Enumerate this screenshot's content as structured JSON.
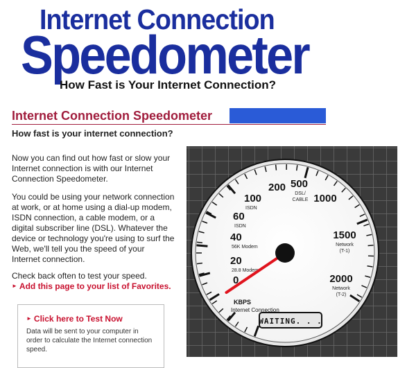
{
  "logo": {
    "line1": "Internet Connection",
    "line2": "Speedometer",
    "tagline": "How Fast is Your Internet Connection?"
  },
  "header": {
    "title": "Internet Connection Speedometer",
    "subtitle": "How fast is your internet connection?"
  },
  "content": {
    "para1": "Now you can find out how fast or slow your Internet connection is with our Internet Connection Speedometer.",
    "para2": "You could be using your network connection at work, or at home using a dial-up modem, ISDN connection, a cable modem, or a digital subscriber line (DSL). Whatever the device or technology you're using to surf the Web, we'll tell you the speed of your Internet connection.",
    "para3": "Check back often to test your speed.",
    "favorites_link": "Add this page to your list of Favorites."
  },
  "test_box": {
    "link": "Click here to Test Now",
    "note": "Data will be sent to your computer in order to calculate the Internet connection speed."
  },
  "gauge": {
    "ticks": [
      {
        "value": "0"
      },
      {
        "value": "20",
        "sub": "28.8 Modem"
      },
      {
        "value": "40",
        "sub": "56K Modem"
      },
      {
        "value": "60",
        "sub": "ISDN"
      },
      {
        "value": "100",
        "sub": "ISDN"
      },
      {
        "value": "200"
      },
      {
        "value": "500",
        "sub": "DSL/ CABLE"
      },
      {
        "value": "1000"
      },
      {
        "value": "1500",
        "sub": "Network (T-1)"
      },
      {
        "value": "2000",
        "sub": "Network (T-2)"
      }
    ],
    "units": "KBPS",
    "units_sub": "Internet Connection",
    "status": "WAITING. . .",
    "current_value_kbps": 20,
    "colors": {
      "needle": "#e0141e",
      "panel": "#3a3a3a",
      "grid": "#6a6a6a"
    }
  },
  "colors": {
    "heading": "#a01c3c",
    "logo": "#1a2e9e",
    "link": "#c8102e",
    "bar": "#2a5bd7"
  }
}
